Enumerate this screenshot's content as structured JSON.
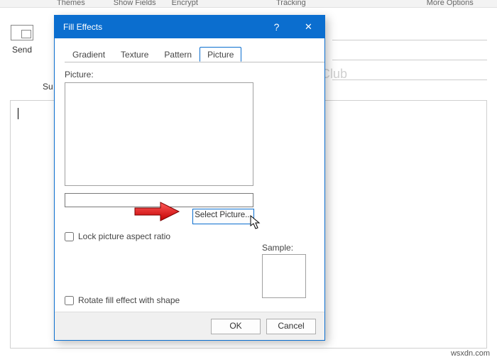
{
  "ribbon": {
    "groups": [
      "Themes",
      "Show Fields",
      "Encrypt",
      "Tracking",
      "More Options"
    ]
  },
  "mail": {
    "send_label": "Send",
    "subject_prefix": "Su"
  },
  "watermark": "TheWindowsClub",
  "attribution": "wsxdn.com",
  "dialog": {
    "title": "Fill Effects",
    "help": "?",
    "close": "✕",
    "tabs": {
      "gradient": "Gradient",
      "texture": "Texture",
      "pattern": "Pattern",
      "picture": "Picture"
    },
    "picture_label": "Picture:",
    "name_value": "",
    "select_picture": "Select Picture...",
    "lock_aspect": "Lock picture aspect ratio",
    "rotate_fill": "Rotate fill effect with shape",
    "sample_label": "Sample:",
    "ok": "OK",
    "cancel": "Cancel"
  }
}
